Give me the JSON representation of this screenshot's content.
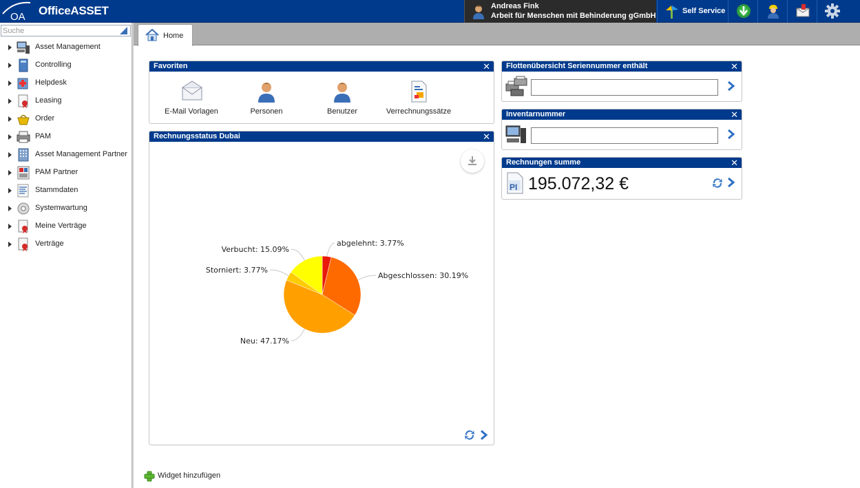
{
  "app": {
    "title": "OfficeASSET",
    "logo_text": "OA"
  },
  "user": {
    "name": "Andreas Fink",
    "organization": "Arbeit für Menschen mit Behinderung gGmbH"
  },
  "toolbar": {
    "self_service_label": "Self Service",
    "icons": [
      "self-service-icon",
      "download-icon",
      "support-icon",
      "mail-icon",
      "gear-icon"
    ]
  },
  "sidebar": {
    "search": {
      "placeholder": "Suche",
      "value": ""
    },
    "items": [
      {
        "label": "Asset Management",
        "icon": "computer-icon"
      },
      {
        "label": "Controlling",
        "icon": "controlling-icon"
      },
      {
        "label": "Helpdesk",
        "icon": "helpdesk-icon"
      },
      {
        "label": "Leasing",
        "icon": "leasing-icon"
      },
      {
        "label": "Order",
        "icon": "basket-icon"
      },
      {
        "label": "PAM",
        "icon": "printer-icon"
      },
      {
        "label": "Asset Management Partner",
        "icon": "building-icon"
      },
      {
        "label": "PAM Partner",
        "icon": "pam-partner-icon"
      },
      {
        "label": "Stammdaten",
        "icon": "list-icon"
      },
      {
        "label": "Systemwartung",
        "icon": "wrench-icon"
      },
      {
        "label": "Meine Verträge",
        "icon": "contract-icon"
      },
      {
        "label": "Verträge",
        "icon": "contract-icon"
      }
    ]
  },
  "tabs": [
    {
      "label": "Home",
      "icon": "home-icon",
      "active": true
    }
  ],
  "widgets": {
    "favorites": {
      "title": "Favoriten",
      "items": [
        {
          "label": "E-Mail Vorlagen",
          "icon": "envelope-icon"
        },
        {
          "label": "Personen",
          "icon": "person-icon"
        },
        {
          "label": "Benutzer",
          "icon": "user-icon"
        },
        {
          "label": "Verrechnungssätze",
          "icon": "document-icon"
        }
      ]
    },
    "chart": {
      "title": "Rechnungsstatus Dubai"
    },
    "serial": {
      "title": "Flottenübersicht Seriennummer enthält",
      "value": ""
    },
    "inventory": {
      "title": "Inventarnummer",
      "value": ""
    },
    "sum": {
      "title": "Rechnungen summe",
      "value": "195.072,32 €"
    }
  },
  "add_widget_label": "Widget hinzufügen",
  "colors": {
    "header": "#003a8c",
    "user_box": "#2b2b2b",
    "tab_strip": "#aeaeae"
  },
  "chart_data": {
    "type": "pie",
    "title": "",
    "legend": "none",
    "slices": [
      {
        "label": "abgelehnt",
        "value": 3.77,
        "display": "abgelehnt: 3.77%",
        "color": "#e8190a"
      },
      {
        "label": "Abgeschlossen",
        "value": 30.19,
        "display": "Abgeschlossen: 30.19%",
        "color": "#ff6a00"
      },
      {
        "label": "Neu",
        "value": 47.17,
        "display": "Neu: 47.17%",
        "color": "#ffa000"
      },
      {
        "label": "Storniert",
        "value": 3.77,
        "display": "Storniert: 3.77%",
        "color": "#ffcc00"
      },
      {
        "label": "Verbucht",
        "value": 15.09,
        "display": "Verbucht: 15.09%",
        "color": "#ffff00"
      }
    ]
  }
}
